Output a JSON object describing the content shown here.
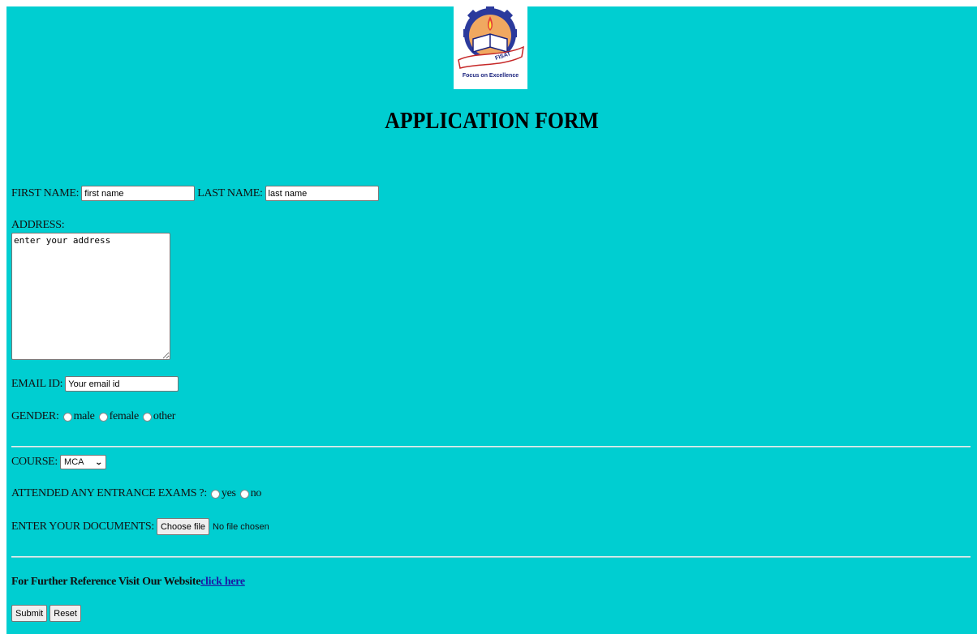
{
  "logo": {
    "caption": "Focus on Excellence",
    "badge_text": "FISAT"
  },
  "title": "APPLICATION FORM",
  "name_row": {
    "first_label": "FIRST NAME:",
    "first_placeholder": "first name",
    "last_label": "LAST NAME:",
    "last_placeholder": "last name"
  },
  "address": {
    "label": "ADDRESS:",
    "placeholder": "enter your address"
  },
  "email": {
    "label": "EMAIL ID:",
    "placeholder": "Your email id"
  },
  "gender": {
    "label": "GENDER:",
    "options": [
      "male",
      "female",
      "other"
    ]
  },
  "course": {
    "label": "COURSE:",
    "selected": "MCA"
  },
  "entrance": {
    "label": "ATTENDED ANY ENTRANCE EXAMS ?:",
    "options": [
      "yes",
      "no"
    ]
  },
  "documents": {
    "label": "ENTER YOUR DOCUMENTS:",
    "button": "Choose file",
    "status": "No file chosen"
  },
  "reference": {
    "text": "For Further Reference Visit Our Website",
    "link": "click here"
  },
  "actions": {
    "submit": "Submit",
    "reset": "Reset"
  },
  "colors": {
    "background": "#00ced1",
    "link": "#1a1aa6"
  }
}
